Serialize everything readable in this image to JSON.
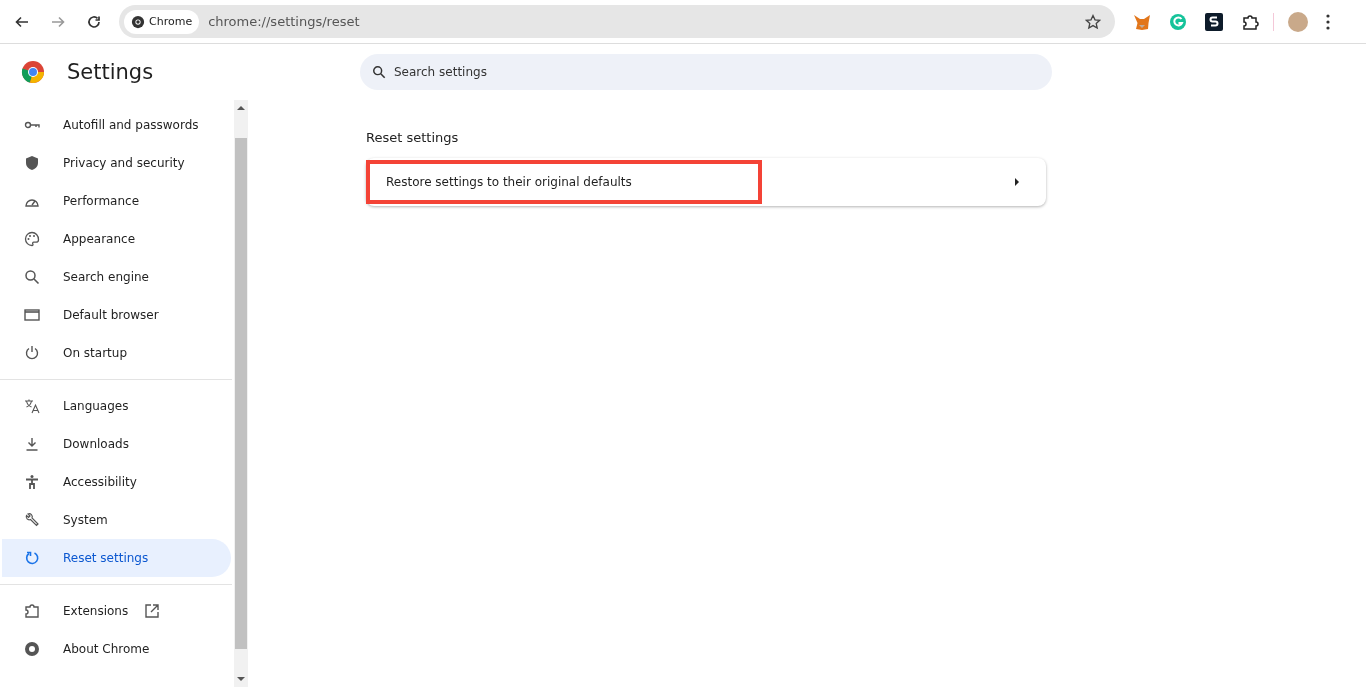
{
  "toolbar": {
    "site_chip": "Chrome",
    "url": "chrome://settings/reset"
  },
  "header": {
    "title": "Settings",
    "search": {
      "placeholder": "Search settings"
    }
  },
  "sidebar": {
    "groups": [
      {
        "items": [
          {
            "label": "Autofill and passwords",
            "selected": false
          },
          {
            "label": "Privacy and security",
            "selected": false
          },
          {
            "label": "Performance",
            "selected": false
          },
          {
            "label": "Appearance",
            "selected": false
          },
          {
            "label": "Search engine",
            "selected": false
          },
          {
            "label": "Default browser",
            "selected": false
          },
          {
            "label": "On startup",
            "selected": false
          }
        ]
      },
      {
        "items": [
          {
            "label": "Languages",
            "selected": false
          },
          {
            "label": "Downloads",
            "selected": false
          },
          {
            "label": "Accessibility",
            "selected": false
          },
          {
            "label": "System",
            "selected": false
          },
          {
            "label": "Reset settings",
            "selected": true
          }
        ]
      },
      {
        "items": [
          {
            "label": "Extensions",
            "selected": false,
            "external": true
          },
          {
            "label": "About Chrome",
            "selected": false,
            "external": false
          }
        ]
      }
    ]
  },
  "main": {
    "section_title": "Reset settings",
    "rows": [
      {
        "label": "Restore settings to their original defaults",
        "highlighted": true
      }
    ]
  }
}
